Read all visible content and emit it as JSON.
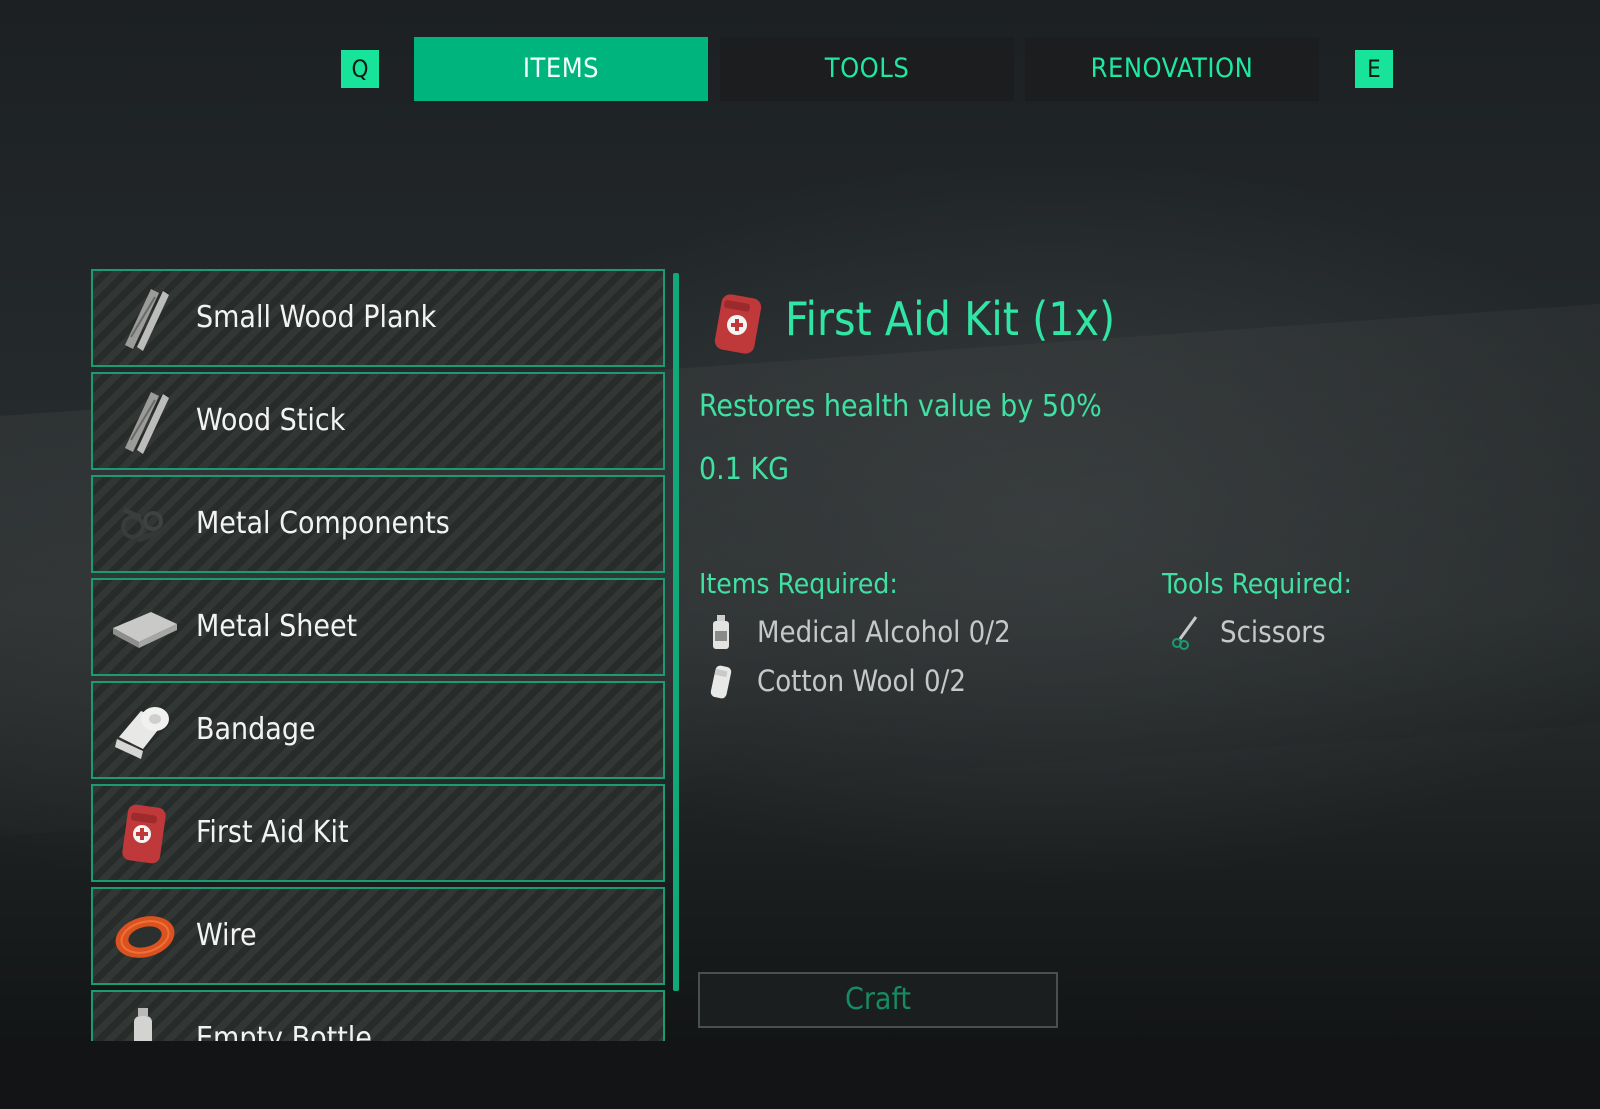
{
  "tabs": {
    "prev_key": "Q",
    "next_key": "E",
    "items": [
      {
        "label": "ITEMS",
        "active": true
      },
      {
        "label": "TOOLS",
        "active": false
      },
      {
        "label": "RENOVATION",
        "active": false
      }
    ]
  },
  "list": {
    "items": [
      {
        "label": "Small Wood Plank",
        "icon": "wood-plank-icon"
      },
      {
        "label": "Wood Stick",
        "icon": "wood-stick-icon"
      },
      {
        "label": "Metal Components",
        "icon": "metal-components-icon"
      },
      {
        "label": "Metal Sheet",
        "icon": "metal-sheet-icon"
      },
      {
        "label": "Bandage",
        "icon": "bandage-icon"
      },
      {
        "label": "First Aid Kit",
        "icon": "first-aid-kit-icon"
      },
      {
        "label": "Wire",
        "icon": "wire-icon"
      },
      {
        "label": "Empty Bottle",
        "icon": "bottle-icon"
      }
    ]
  },
  "detail": {
    "title": "First Aid Kit (1x)",
    "icon": "first-aid-kit-icon",
    "description": "Restores health value by 50%",
    "weight": "0.1 KG",
    "items_required_label": "Items Required:",
    "tools_required_label": "Tools Required:",
    "items_required": [
      {
        "text": "Medical Alcohol 0/2",
        "icon": "alcohol-bottle-icon"
      },
      {
        "text": "Cotton Wool 0/2",
        "icon": "cotton-wool-icon"
      }
    ],
    "tools_required": [
      {
        "text": "Scissors",
        "icon": "scissors-icon"
      }
    ],
    "craft_label": "Craft"
  },
  "colors": {
    "accent": "#17e39a",
    "active_tab": "#00b47e",
    "item_border": "#1a9c71",
    "muted_text": "#c7c9c8"
  }
}
